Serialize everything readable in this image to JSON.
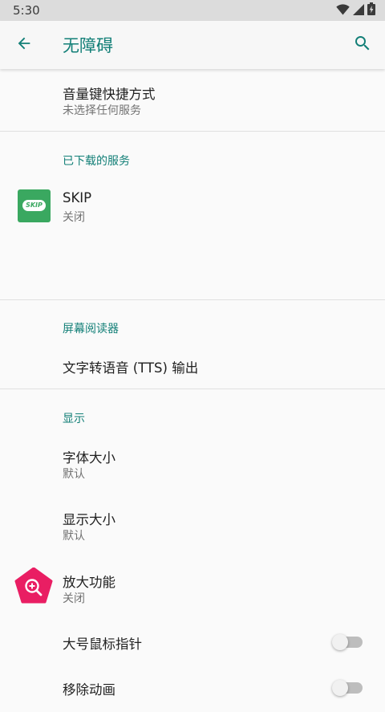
{
  "status_bar": {
    "time": "5:30",
    "icons": [
      "wifi-icon",
      "signal-icon",
      "battery-icon"
    ]
  },
  "app_bar": {
    "title": "无障碍",
    "back_icon": "arrow-back-icon",
    "search_icon": "search-icon"
  },
  "colors": {
    "accent": "#127f77",
    "skip_green": "#3aa860",
    "magnify_pink": "#e91e63"
  },
  "volume_shortcut": {
    "title": "音量键快捷方式",
    "summary": "未选择任何服务"
  },
  "downloaded_services": {
    "header": "已下载的服务",
    "skip": {
      "title": "SKIP",
      "summary": "关闭",
      "icon_text": "SKIP"
    }
  },
  "screen_reader": {
    "header": "屏幕阅读器",
    "tts": {
      "title": "文字转语音 (TTS) 输出"
    }
  },
  "display": {
    "header": "显示",
    "font_size": {
      "title": "字体大小",
      "summary": "默认"
    },
    "display_size": {
      "title": "显示大小",
      "summary": "默认"
    },
    "magnification": {
      "title": "放大功能",
      "summary": "关闭"
    },
    "large_pointer": {
      "title": "大号鼠标指针",
      "enabled": false
    },
    "remove_animations": {
      "title": "移除动画",
      "enabled": false
    }
  }
}
